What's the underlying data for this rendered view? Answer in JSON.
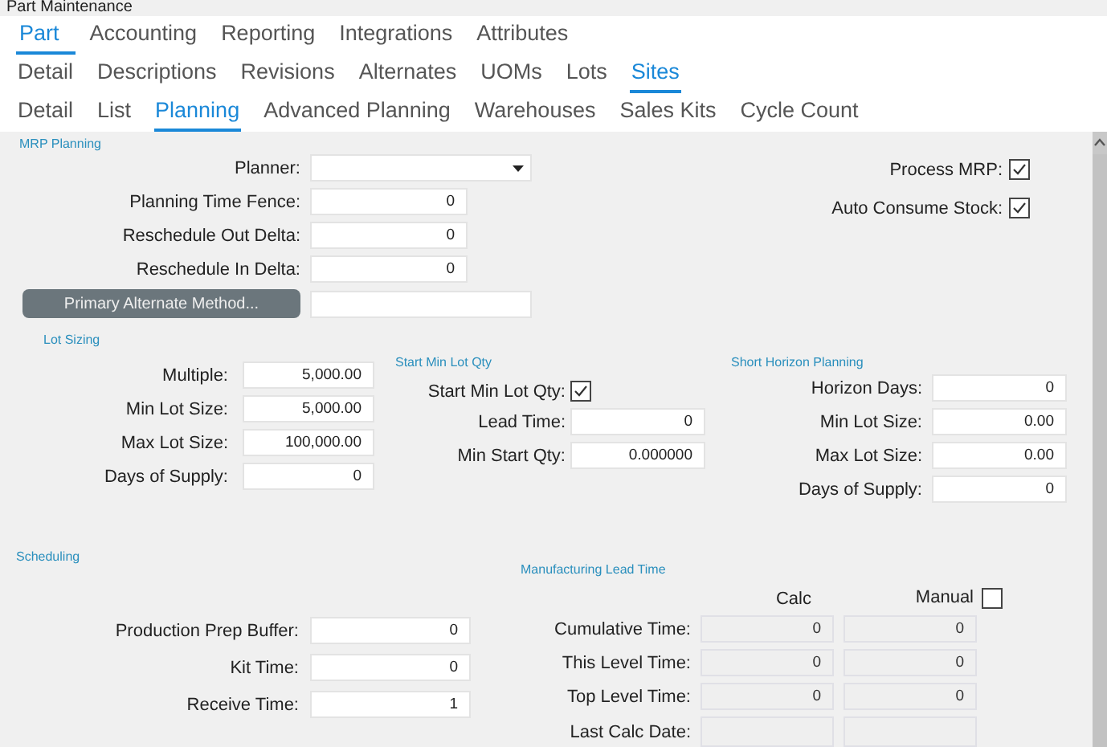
{
  "window": {
    "title": "Part Maintenance"
  },
  "tab_rows": [
    {
      "tabs": [
        {
          "label": "Part",
          "selected": true
        },
        {
          "label": "Accounting",
          "selected": false
        },
        {
          "label": "Reporting",
          "selected": false
        },
        {
          "label": "Integrations",
          "selected": false
        },
        {
          "label": "Attributes",
          "selected": false
        }
      ]
    },
    {
      "tabs": [
        {
          "label": "Detail",
          "selected": false
        },
        {
          "label": "Descriptions",
          "selected": false
        },
        {
          "label": "Revisions",
          "selected": false
        },
        {
          "label": "Alternates",
          "selected": false
        },
        {
          "label": "UOMs",
          "selected": false
        },
        {
          "label": "Lots",
          "selected": false
        },
        {
          "label": "Sites",
          "selected": true
        }
      ]
    },
    {
      "tabs": [
        {
          "label": "Detail",
          "selected": false
        },
        {
          "label": "List",
          "selected": false
        },
        {
          "label": "Planning",
          "selected": true
        },
        {
          "label": "Advanced Planning",
          "selected": false
        },
        {
          "label": "Warehouses",
          "selected": false
        },
        {
          "label": "Sales Kits",
          "selected": false
        },
        {
          "label": "Cycle Count",
          "selected": false
        }
      ]
    }
  ],
  "mrp_planning": {
    "title": "MRP Planning",
    "fields": [
      {
        "label": "Planner:",
        "kind": "dropdown"
      },
      {
        "label": "Planning Time Fence:",
        "kind": "number",
        "value": "0"
      },
      {
        "label": "Reschedule Out Delta:",
        "kind": "number",
        "value": "0"
      },
      {
        "label": "Reschedule In Delta:",
        "kind": "number",
        "value": "0"
      }
    ],
    "button": "Primary Alternate Method...",
    "checkboxes": [
      {
        "label": "Process MRP:",
        "checked": true
      },
      {
        "label": "Auto Consume Stock:",
        "checked": true
      }
    ]
  },
  "lot_sizing": {
    "title": "Lot Sizing",
    "fields": [
      {
        "label": "Multiple:",
        "value": "5,000.00"
      },
      {
        "label": "Min Lot Size:",
        "value": "5,000.00"
      },
      {
        "label": "Max Lot Size:",
        "value": "100,000.00"
      },
      {
        "label": "Days of Supply:",
        "value": "0"
      }
    ]
  },
  "start_min_lot_qty": {
    "title": "Start Min Lot Qty",
    "checkbox": {
      "label": "Start Min Lot Qty:",
      "checked": true
    },
    "fields": [
      {
        "label": "Lead Time:",
        "value": "0"
      },
      {
        "label": "Min Start Qty:",
        "value": "0.000000"
      }
    ]
  },
  "short_horizon_planning": {
    "title": "Short Horizon Planning",
    "fields": [
      {
        "label": "Horizon Days:",
        "value": "0"
      },
      {
        "label": "Min Lot Size:",
        "value": "0.00"
      },
      {
        "label": "Max Lot Size:",
        "value": "0.00"
      },
      {
        "label": "Days of Supply:",
        "value": "0"
      }
    ]
  },
  "scheduling": {
    "title": "Scheduling",
    "fields": [
      {
        "label": "Production Prep Buffer:",
        "value": "0"
      },
      {
        "label": "Kit Time:",
        "value": "0"
      },
      {
        "label": "Receive Time:",
        "value": "1"
      }
    ]
  },
  "manufacturing_lead_time": {
    "title": "Manufacturing Lead Time",
    "calc_header": "Calc",
    "manual": {
      "label": "Manual",
      "checked": false
    },
    "rows": [
      {
        "label": "Cumulative Time:",
        "calc": "0",
        "manual": "0"
      },
      {
        "label": "This Level Time:",
        "calc": "0",
        "manual": "0"
      },
      {
        "label": "Top Level Time:",
        "calc": "0",
        "manual": "0"
      },
      {
        "label": "Last Calc Date:"
      }
    ]
  }
}
